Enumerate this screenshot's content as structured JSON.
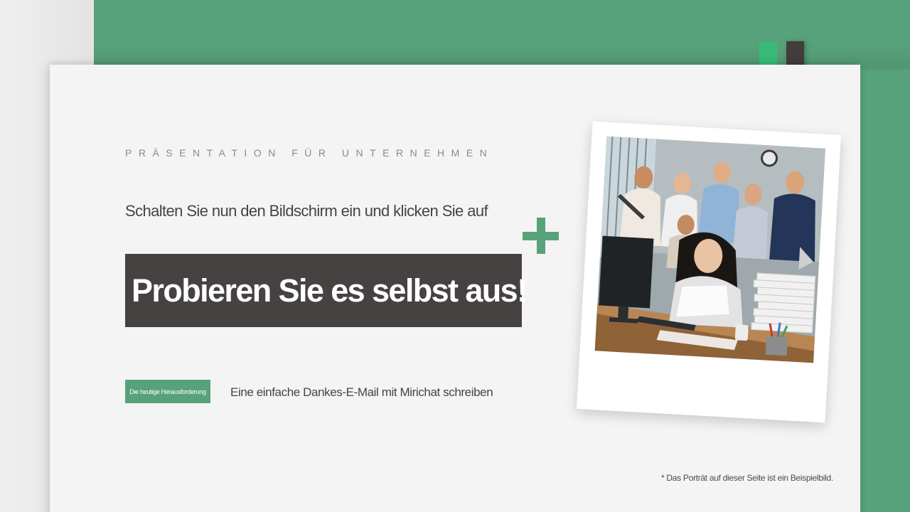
{
  "slide": {
    "eyebrow": "PRÄSENTATION  FÜR UNTERNEHMEN",
    "subtitle": "Schalten Sie nun den Bildschirm ein und klicken Sie auf",
    "cta_label": "Probieren Sie es selbst aus!",
    "badge_label": "Die heutige Herausforderung",
    "challenge_text": "Eine einfache Dankes-E-Mail mit Mirichat schreiben",
    "footnote": "* Das Porträt auf dieser Seite ist ein Beispielbild."
  },
  "colors": {
    "brand_green": "#58a27b",
    "tab_green": "#37bb77",
    "dark": "#464242",
    "card": "#f5f4f4"
  },
  "icons": {
    "plus": "plus-icon"
  }
}
